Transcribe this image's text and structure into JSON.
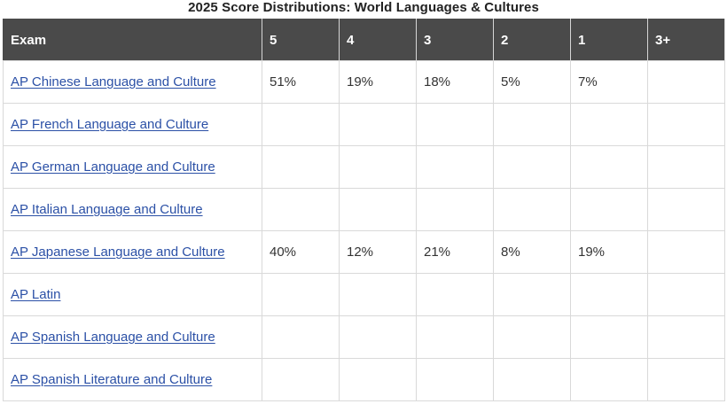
{
  "title": "2025 Score Distributions: World Languages & Cultures",
  "headers": [
    "Exam",
    "5",
    "4",
    "3",
    "2",
    "1",
    "3+"
  ],
  "rows": [
    {
      "exam": "AP Chinese Language and Culture",
      "values": [
        "51%",
        "19%",
        "18%",
        "5%",
        "7%",
        ""
      ]
    },
    {
      "exam": "AP French Language and Culture",
      "values": [
        "",
        "",
        "",
        "",
        "",
        ""
      ]
    },
    {
      "exam": "AP German Language and Culture",
      "values": [
        "",
        "",
        "",
        "",
        "",
        ""
      ]
    },
    {
      "exam": "AP Italian Language and Culture",
      "values": [
        "",
        "",
        "",
        "",
        "",
        ""
      ]
    },
    {
      "exam": "AP Japanese Language and Culture",
      "values": [
        "40%",
        "12%",
        "21%",
        "8%",
        "19%",
        ""
      ]
    },
    {
      "exam": "AP Latin",
      "values": [
        "",
        "",
        "",
        "",
        "",
        ""
      ]
    },
    {
      "exam": "AP Spanish Language and Culture",
      "values": [
        "",
        "",
        "",
        "",
        "",
        ""
      ]
    },
    {
      "exam": "AP Spanish Literature and Culture",
      "values": [
        "",
        "",
        "",
        "",
        "",
        ""
      ]
    }
  ],
  "colors": {
    "header_bg": "#4a4a4a",
    "header_text": "#ffffff",
    "link": "#2b50a6",
    "border": "#d9d9d9"
  }
}
